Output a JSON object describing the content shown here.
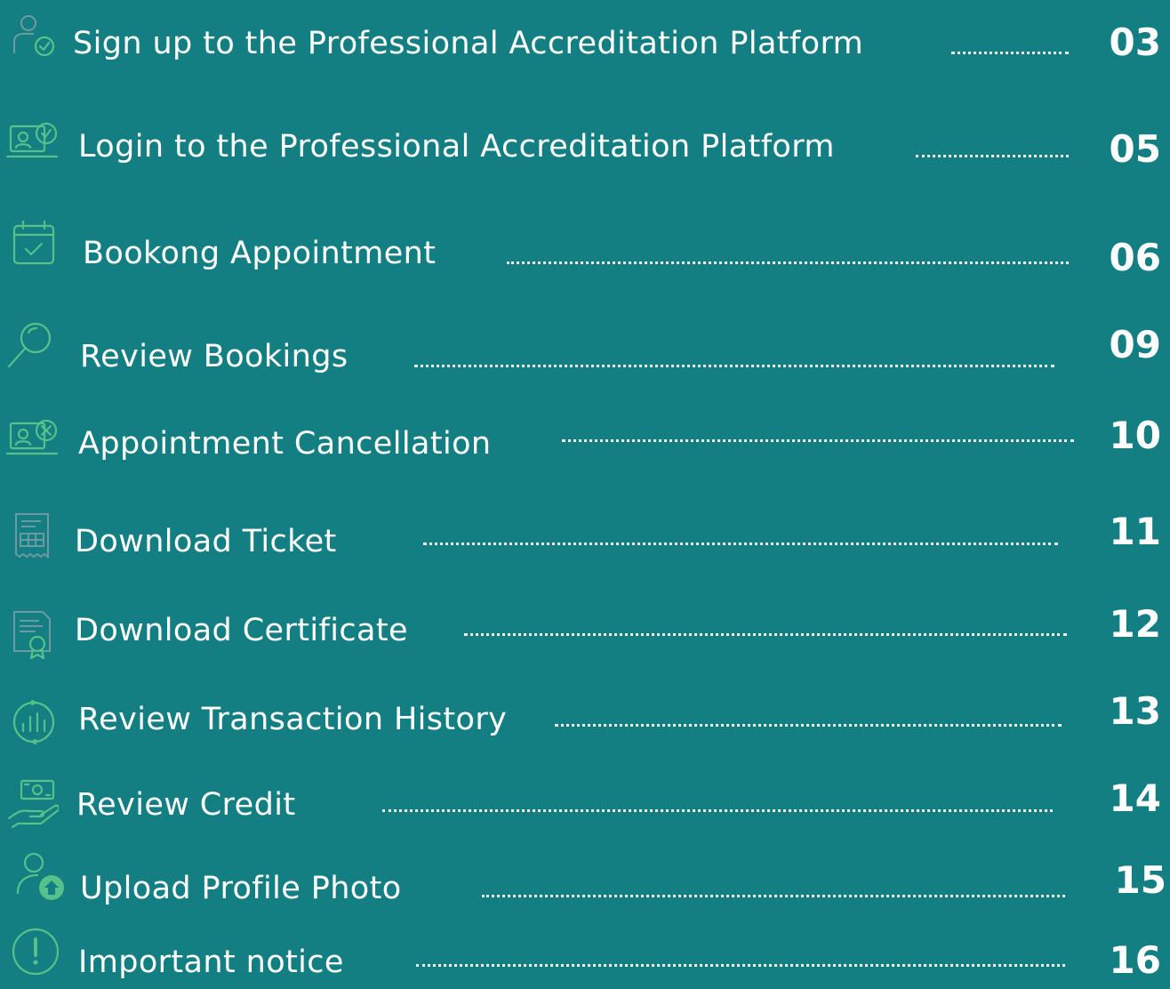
{
  "toc": {
    "items": [
      {
        "title": "Sign up to the Professional Accreditation Platform",
        "page": "03",
        "icon": "user-check-icon"
      },
      {
        "title": "Login to the Professional Accreditation Platform",
        "page": "05",
        "icon": "laptop-check-icon"
      },
      {
        "title": "Bookong Appointment",
        "page": "06",
        "icon": "calendar-check-icon"
      },
      {
        "title": "Review Bookings",
        "page": "09",
        "icon": "search-icon"
      },
      {
        "title": "Appointment Cancellation",
        "page": "10",
        "icon": "laptop-cancel-icon"
      },
      {
        "title": "Download Ticket",
        "page": "11",
        "icon": "ticket-icon"
      },
      {
        "title": "Download Certificate",
        "page": "12",
        "icon": "certificate-icon"
      },
      {
        "title": "Review Transaction History",
        "page": "13",
        "icon": "transaction-history-icon"
      },
      {
        "title": "Review Credit",
        "page": "14",
        "icon": "credit-hand-icon"
      },
      {
        "title": "Upload Profile Photo",
        "page": "15",
        "icon": "profile-upload-icon"
      },
      {
        "title": "Important notice",
        "page": "16",
        "icon": "exclamation-icon"
      }
    ]
  },
  "colors": {
    "background": "#137f82",
    "icon_accent": "#58c08b",
    "text": "#ffffff"
  }
}
